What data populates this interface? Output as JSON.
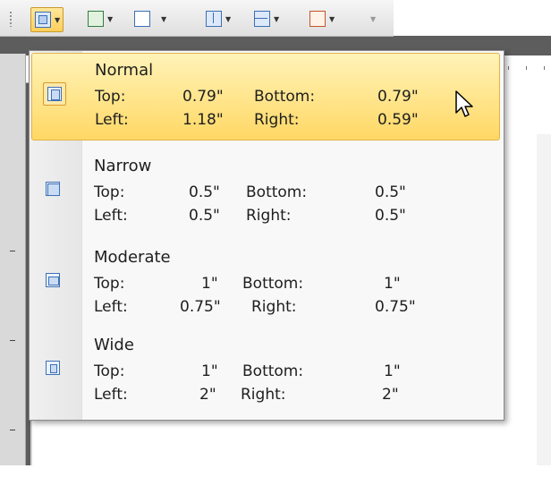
{
  "toolbar": {
    "buttons": [
      {
        "name": "page-margins",
        "icon": "page-margins-icon",
        "active": true
      },
      {
        "name": "orientation",
        "icon": "orientation-icon",
        "active": false
      },
      {
        "name": "size",
        "icon": "page-size-icon",
        "active": false
      },
      {
        "name": "columns",
        "icon": "columns-icon",
        "active": false
      },
      {
        "name": "breaks",
        "icon": "breaks-icon",
        "active": false
      },
      {
        "name": "line-numbers",
        "icon": "line-numbers-icon",
        "active": false
      }
    ]
  },
  "margins_menu": {
    "items": [
      {
        "title": "Normal",
        "selected": true,
        "hovered": true,
        "top_label": "Top:",
        "top_value": "0.79\"",
        "bottom_label": "Bottom:",
        "bottom_value": "0.79\"",
        "left_label": "Left:",
        "left_value": "1.18\"",
        "right_label": "Right:",
        "right_value": "0.59\""
      },
      {
        "title": "Narrow",
        "selected": false,
        "hovered": false,
        "top_label": "Top:",
        "top_value": "0.5\"",
        "bottom_label": "Bottom:",
        "bottom_value": "0.5\"",
        "left_label": "Left:",
        "left_value": "0.5\"",
        "right_label": "Right:",
        "right_value": "0.5\""
      },
      {
        "title": "Moderate",
        "selected": false,
        "hovered": false,
        "top_label": "Top:",
        "top_value": "1\"",
        "bottom_label": "Bottom:",
        "bottom_value": "1\"",
        "left_label": "Left:",
        "left_value": "0.75\"",
        "right_label": "Right:",
        "right_value": "0.75\""
      },
      {
        "title": "Wide",
        "selected": false,
        "hovered": false,
        "top_label": "Top:",
        "top_value": "1\"",
        "bottom_label": "Bottom:",
        "bottom_value": "1\"",
        "left_label": "Left:",
        "left_value": "2\"",
        "right_label": "Right:",
        "right_value": "2\""
      }
    ]
  },
  "colors": {
    "hover_top": "#fff3b8",
    "hover_bottom": "#ffd865",
    "hover_border": "#e0b34a",
    "icon_blue": "#3f70b6"
  }
}
